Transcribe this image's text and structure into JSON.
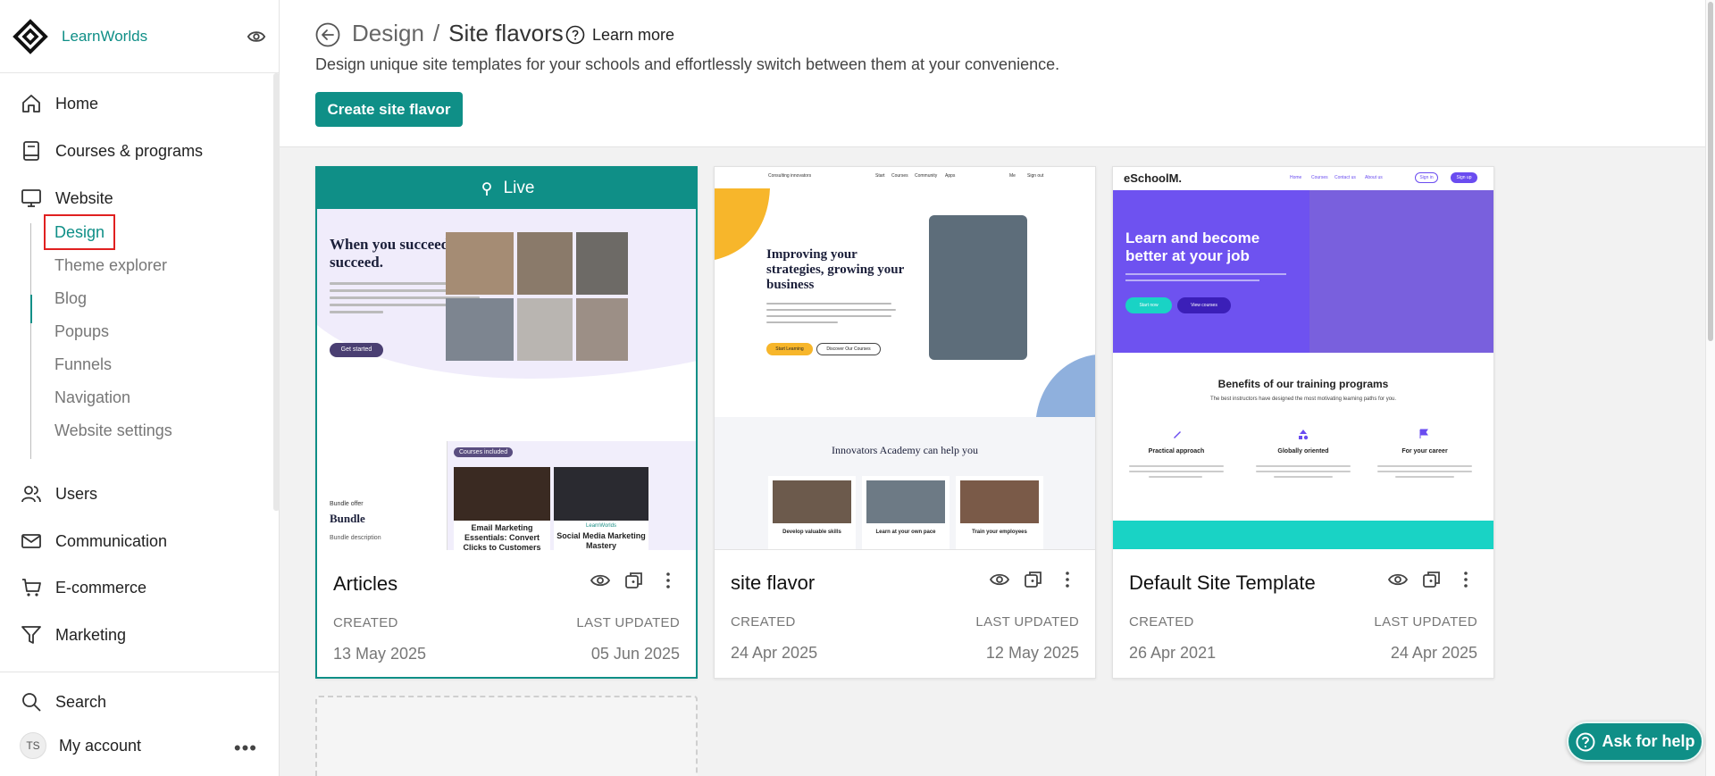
{
  "brand": {
    "name": "LearnWorlds"
  },
  "sidebar": {
    "items": [
      {
        "label": "Home",
        "icon": "home-icon"
      },
      {
        "label": "Courses & programs",
        "icon": "book-icon"
      },
      {
        "label": "Website",
        "icon": "monitor-icon"
      },
      {
        "label": "Users",
        "icon": "users-icon"
      },
      {
        "label": "Communication",
        "icon": "mail-icon"
      },
      {
        "label": "E-commerce",
        "icon": "cart-icon"
      },
      {
        "label": "Marketing",
        "icon": "filter-icon"
      }
    ],
    "website_sub": [
      "Design",
      "Theme explorer",
      "Blog",
      "Popups",
      "Funnels",
      "Navigation",
      "Website settings"
    ],
    "bottom": {
      "search": "Search",
      "account": "My account",
      "avatar_initials": "TS"
    }
  },
  "header": {
    "crumb_parent": "Design",
    "crumb_sep": "/",
    "crumb_current": "Site flavors",
    "learn_more": "Learn more",
    "subtitle": "Design unique site templates for your schools and effortlessly switch between them at your convenience.",
    "create_button": "Create site flavor"
  },
  "cards": [
    {
      "title": "Articles",
      "live": true,
      "live_label": "Live",
      "created_label": "CREATED",
      "created": "13 May 2025",
      "updated_label": "LAST UPDATED",
      "updated": "05 Jun 2025",
      "preview": {
        "headline": "When you succeed, we all succeed.",
        "button": "Get started",
        "bundle_small": "Bundle offer",
        "bundle": "Bundle",
        "bundle_desc": "Bundle description",
        "courses_tag": "Courses included",
        "course1": "Email Marketing Essentials: Convert Clicks to Customers",
        "course2_label": "LearnWorlds",
        "course2": "Social Media Marketing Mastery"
      }
    },
    {
      "title": "site flavor",
      "live": false,
      "created_label": "CREATED",
      "created": "24 Apr 2025",
      "updated_label": "LAST UPDATED",
      "updated": "12 May 2025",
      "preview": {
        "logo_text": "Consulting innovators",
        "nav": [
          "Start",
          "Courses",
          "Community",
          "Apps"
        ],
        "user": "Me",
        "signout": "Sign out",
        "headline": "Improving your strategies, growing your business",
        "btn1": "Start Learning",
        "btn2": "Discover Our Courses",
        "section_title": "Innovators Academy can help you",
        "features": [
          "Develop valuable skills",
          "Learn at your own pace",
          "Train your employees"
        ]
      }
    },
    {
      "title": "Default Site Template",
      "live": false,
      "created_label": "CREATED",
      "created": "26 Apr 2021",
      "updated_label": "LAST UPDATED",
      "updated": "24 Apr 2025",
      "preview": {
        "logo": "eSchoolM.",
        "nav": [
          "Home",
          "Courses",
          "Contact us",
          "About us"
        ],
        "signin": "Sign in",
        "signup": "Sign up",
        "headline": "Learn and become better at your job",
        "btn1": "Start now",
        "btn2": "View courses",
        "benefits_title": "Benefits of our training programs",
        "benefits_sub": "The best instructors have designed the most motivating learning paths for you.",
        "benefits": [
          "Practical approach",
          "Globally oriented",
          "For your career"
        ]
      }
    }
  ],
  "help": {
    "label": "Ask for help"
  },
  "colors": {
    "accent": "#0f8f87",
    "purple": "#6a4cf0",
    "highlight": "#e02020"
  }
}
